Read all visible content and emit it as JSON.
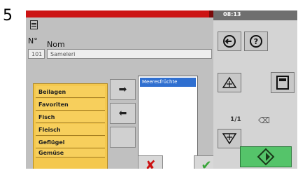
{
  "step_number": "5",
  "status": {
    "time": "08:13"
  },
  "form": {
    "nr_label": "N°",
    "nom_label": "Nom",
    "nr_value": "101",
    "name_value": "Sameleri"
  },
  "categories": [
    "Beilagen",
    "Favoriten",
    "Fisch",
    "Fleisch",
    "Geflügel",
    "Gemüse"
  ],
  "selected_items": [
    "Meeresfrüchte"
  ],
  "move_buttons": {
    "add": "➡",
    "remove": "⬅"
  },
  "actions": {
    "cancel": "✘",
    "confirm": "✔"
  },
  "nav": {
    "page": "1/1"
  },
  "colors": {
    "top_bar": "#cc1414",
    "category_bg": "#f4c84e",
    "selected": "#2f6fd0",
    "start": "#55c46a"
  }
}
